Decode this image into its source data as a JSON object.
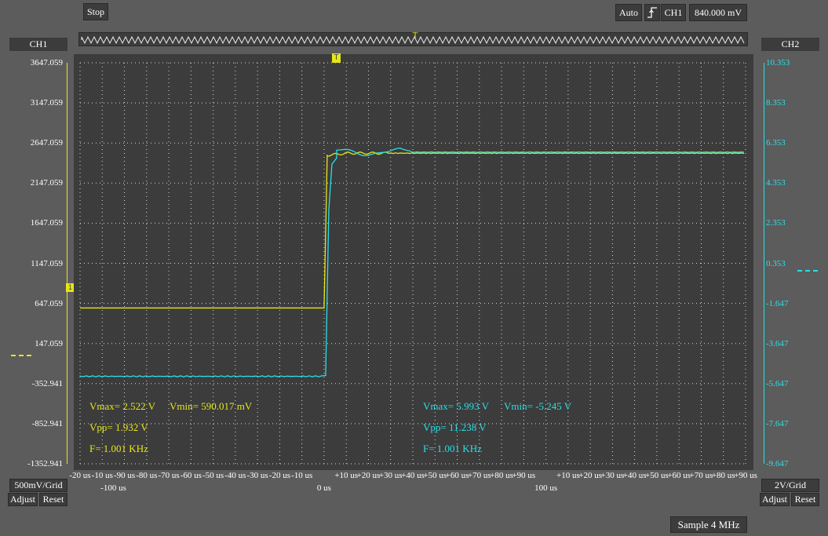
{
  "toolbar": {
    "stop_label": "Stop",
    "auto_label": "Auto",
    "trigger_edge_icon": "rising-edge-icon",
    "trigger_channel": "CH1",
    "trigger_level": "840.000 mV"
  },
  "colors": {
    "ch1": "#e6e619",
    "ch2": "#29e0e6",
    "background": "#5c5c5c",
    "screen": "#3c3c3c"
  },
  "ch1": {
    "label": "CH1",
    "ticks": [
      "3647.059",
      "3147.059",
      "2647.059",
      "2147.059",
      "1647.059",
      "1147.059",
      "647.059",
      "147.059",
      "-352.941",
      "-852.941",
      "-1352.941"
    ],
    "scale": "500mV/Grid",
    "adjust": "Adjust",
    "reset": "Reset",
    "vmax_text": "Vmax= 2.522 V",
    "vmin_text": "Vmin= 590.017 mV",
    "vpp_text": "Vpp= 1.932 V",
    "freq_text": "F= 1.001 KHz"
  },
  "ch2": {
    "label": "CH2",
    "ticks": [
      "10.353",
      "8.353",
      "6.353",
      "4.353",
      "2.353",
      "0.353",
      "-1.647",
      "-3.647",
      "-5.647",
      "-7.647",
      "-9.647"
    ],
    "scale": "2V/Grid",
    "adjust": "Adjust",
    "reset": "Reset",
    "vmax_text": "Vmax= 5.993 V",
    "vmin_text": "Vmin= -5.245 V",
    "vpp_text": "Vpp= 11.238 V",
    "freq_text": "F= 1.001 KHz"
  },
  "x_axis": {
    "ticks": [
      "-20 us",
      "-10 us",
      "-90 us",
      "-80 us",
      "-70 us",
      "-60 us",
      "-50 us",
      "-40 us",
      "-30 us",
      "-20 us",
      "-10 us",
      "",
      "+10 us",
      "+20 us",
      "+30 us",
      "+40 us",
      "+50 us",
      "+60 us",
      "+70 us",
      "+80 us",
      "+90 us",
      "",
      "+10 us",
      "+20 us",
      "+30 us",
      "+40 us",
      "+50 us",
      "+60 us",
      "+70 us",
      "+80 us",
      "+90 us"
    ],
    "major_labels": [
      "-100 us",
      "0 us",
      "100 us"
    ]
  },
  "status": {
    "sample_rate": "Sample 4 MHz"
  },
  "waveforms": {
    "ch1": {
      "low_v": 0.59,
      "high_v": 2.52,
      "edge_us": 0
    },
    "ch2": {
      "low_v": -5.245,
      "high_v": 5.993,
      "edge_us": 0
    }
  }
}
